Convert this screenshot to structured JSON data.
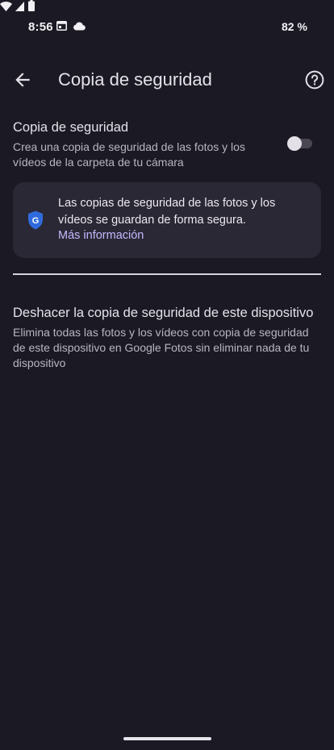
{
  "status_bar": {
    "time": "8:56",
    "battery_text": "82 %",
    "icons": [
      "calendar-icon",
      "cloud-icon",
      "wifi-icon",
      "signal-icon",
      "battery-icon"
    ]
  },
  "app_bar": {
    "title": "Copia de seguridad",
    "back_icon": "arrow-back-icon",
    "help_icon": "help-icon"
  },
  "backup_setting": {
    "title": "Copia de seguridad",
    "description": "Crea una copia de seguridad de las fotos y los vídeos de la carpeta de tu cámara",
    "enabled": false
  },
  "info_card": {
    "text": "Las copias de seguridad de las fotos y los vídeos se guardan de forma segura.",
    "link": "Más información",
    "icon": "google-shield-icon"
  },
  "undo_setting": {
    "title": "Deshacer la copia de seguridad de este dispositivo",
    "description": "Elimina todas las fotos y los vídeos con copia de seguridad de este dispositivo en Google Fotos sin eliminar nada de tu dispositivo"
  },
  "colors": {
    "background": "#1b1a24",
    "card": "#2a2834",
    "link": "#c6b8ff",
    "shield": "#2f6bdc"
  }
}
